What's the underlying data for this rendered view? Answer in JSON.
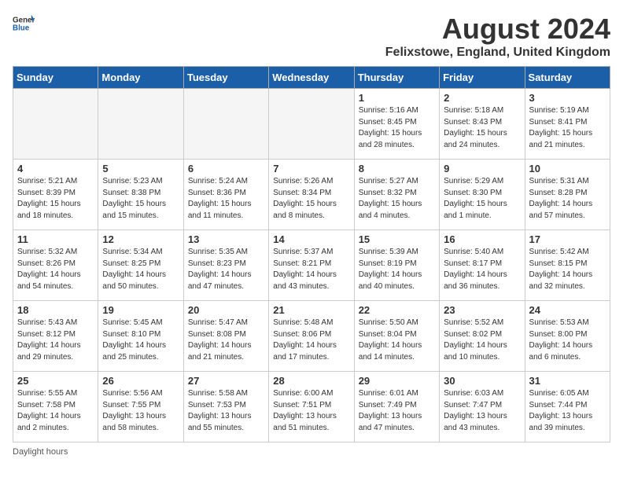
{
  "header": {
    "logo_general": "General",
    "logo_blue": "Blue",
    "month_year": "August 2024",
    "location": "Felixstowe, England, United Kingdom"
  },
  "days_of_week": [
    "Sunday",
    "Monday",
    "Tuesday",
    "Wednesday",
    "Thursday",
    "Friday",
    "Saturday"
  ],
  "weeks": [
    [
      {
        "day": "",
        "info": ""
      },
      {
        "day": "",
        "info": ""
      },
      {
        "day": "",
        "info": ""
      },
      {
        "day": "",
        "info": ""
      },
      {
        "day": "1",
        "info": "Sunrise: 5:16 AM\nSunset: 8:45 PM\nDaylight: 15 hours\nand 28 minutes."
      },
      {
        "day": "2",
        "info": "Sunrise: 5:18 AM\nSunset: 8:43 PM\nDaylight: 15 hours\nand 24 minutes."
      },
      {
        "day": "3",
        "info": "Sunrise: 5:19 AM\nSunset: 8:41 PM\nDaylight: 15 hours\nand 21 minutes."
      }
    ],
    [
      {
        "day": "4",
        "info": "Sunrise: 5:21 AM\nSunset: 8:39 PM\nDaylight: 15 hours\nand 18 minutes."
      },
      {
        "day": "5",
        "info": "Sunrise: 5:23 AM\nSunset: 8:38 PM\nDaylight: 15 hours\nand 15 minutes."
      },
      {
        "day": "6",
        "info": "Sunrise: 5:24 AM\nSunset: 8:36 PM\nDaylight: 15 hours\nand 11 minutes."
      },
      {
        "day": "7",
        "info": "Sunrise: 5:26 AM\nSunset: 8:34 PM\nDaylight: 15 hours\nand 8 minutes."
      },
      {
        "day": "8",
        "info": "Sunrise: 5:27 AM\nSunset: 8:32 PM\nDaylight: 15 hours\nand 4 minutes."
      },
      {
        "day": "9",
        "info": "Sunrise: 5:29 AM\nSunset: 8:30 PM\nDaylight: 15 hours\nand 1 minute."
      },
      {
        "day": "10",
        "info": "Sunrise: 5:31 AM\nSunset: 8:28 PM\nDaylight: 14 hours\nand 57 minutes."
      }
    ],
    [
      {
        "day": "11",
        "info": "Sunrise: 5:32 AM\nSunset: 8:26 PM\nDaylight: 14 hours\nand 54 minutes."
      },
      {
        "day": "12",
        "info": "Sunrise: 5:34 AM\nSunset: 8:25 PM\nDaylight: 14 hours\nand 50 minutes."
      },
      {
        "day": "13",
        "info": "Sunrise: 5:35 AM\nSunset: 8:23 PM\nDaylight: 14 hours\nand 47 minutes."
      },
      {
        "day": "14",
        "info": "Sunrise: 5:37 AM\nSunset: 8:21 PM\nDaylight: 14 hours\nand 43 minutes."
      },
      {
        "day": "15",
        "info": "Sunrise: 5:39 AM\nSunset: 8:19 PM\nDaylight: 14 hours\nand 40 minutes."
      },
      {
        "day": "16",
        "info": "Sunrise: 5:40 AM\nSunset: 8:17 PM\nDaylight: 14 hours\nand 36 minutes."
      },
      {
        "day": "17",
        "info": "Sunrise: 5:42 AM\nSunset: 8:15 PM\nDaylight: 14 hours\nand 32 minutes."
      }
    ],
    [
      {
        "day": "18",
        "info": "Sunrise: 5:43 AM\nSunset: 8:12 PM\nDaylight: 14 hours\nand 29 minutes."
      },
      {
        "day": "19",
        "info": "Sunrise: 5:45 AM\nSunset: 8:10 PM\nDaylight: 14 hours\nand 25 minutes."
      },
      {
        "day": "20",
        "info": "Sunrise: 5:47 AM\nSunset: 8:08 PM\nDaylight: 14 hours\nand 21 minutes."
      },
      {
        "day": "21",
        "info": "Sunrise: 5:48 AM\nSunset: 8:06 PM\nDaylight: 14 hours\nand 17 minutes."
      },
      {
        "day": "22",
        "info": "Sunrise: 5:50 AM\nSunset: 8:04 PM\nDaylight: 14 hours\nand 14 minutes."
      },
      {
        "day": "23",
        "info": "Sunrise: 5:52 AM\nSunset: 8:02 PM\nDaylight: 14 hours\nand 10 minutes."
      },
      {
        "day": "24",
        "info": "Sunrise: 5:53 AM\nSunset: 8:00 PM\nDaylight: 14 hours\nand 6 minutes."
      }
    ],
    [
      {
        "day": "25",
        "info": "Sunrise: 5:55 AM\nSunset: 7:58 PM\nDaylight: 14 hours\nand 2 minutes."
      },
      {
        "day": "26",
        "info": "Sunrise: 5:56 AM\nSunset: 7:55 PM\nDaylight: 13 hours\nand 58 minutes."
      },
      {
        "day": "27",
        "info": "Sunrise: 5:58 AM\nSunset: 7:53 PM\nDaylight: 13 hours\nand 55 minutes."
      },
      {
        "day": "28",
        "info": "Sunrise: 6:00 AM\nSunset: 7:51 PM\nDaylight: 13 hours\nand 51 minutes."
      },
      {
        "day": "29",
        "info": "Sunrise: 6:01 AM\nSunset: 7:49 PM\nDaylight: 13 hours\nand 47 minutes."
      },
      {
        "day": "30",
        "info": "Sunrise: 6:03 AM\nSunset: 7:47 PM\nDaylight: 13 hours\nand 43 minutes."
      },
      {
        "day": "31",
        "info": "Sunrise: 6:05 AM\nSunset: 7:44 PM\nDaylight: 13 hours\nand 39 minutes."
      }
    ]
  ],
  "footer": {
    "note": "Daylight hours"
  }
}
